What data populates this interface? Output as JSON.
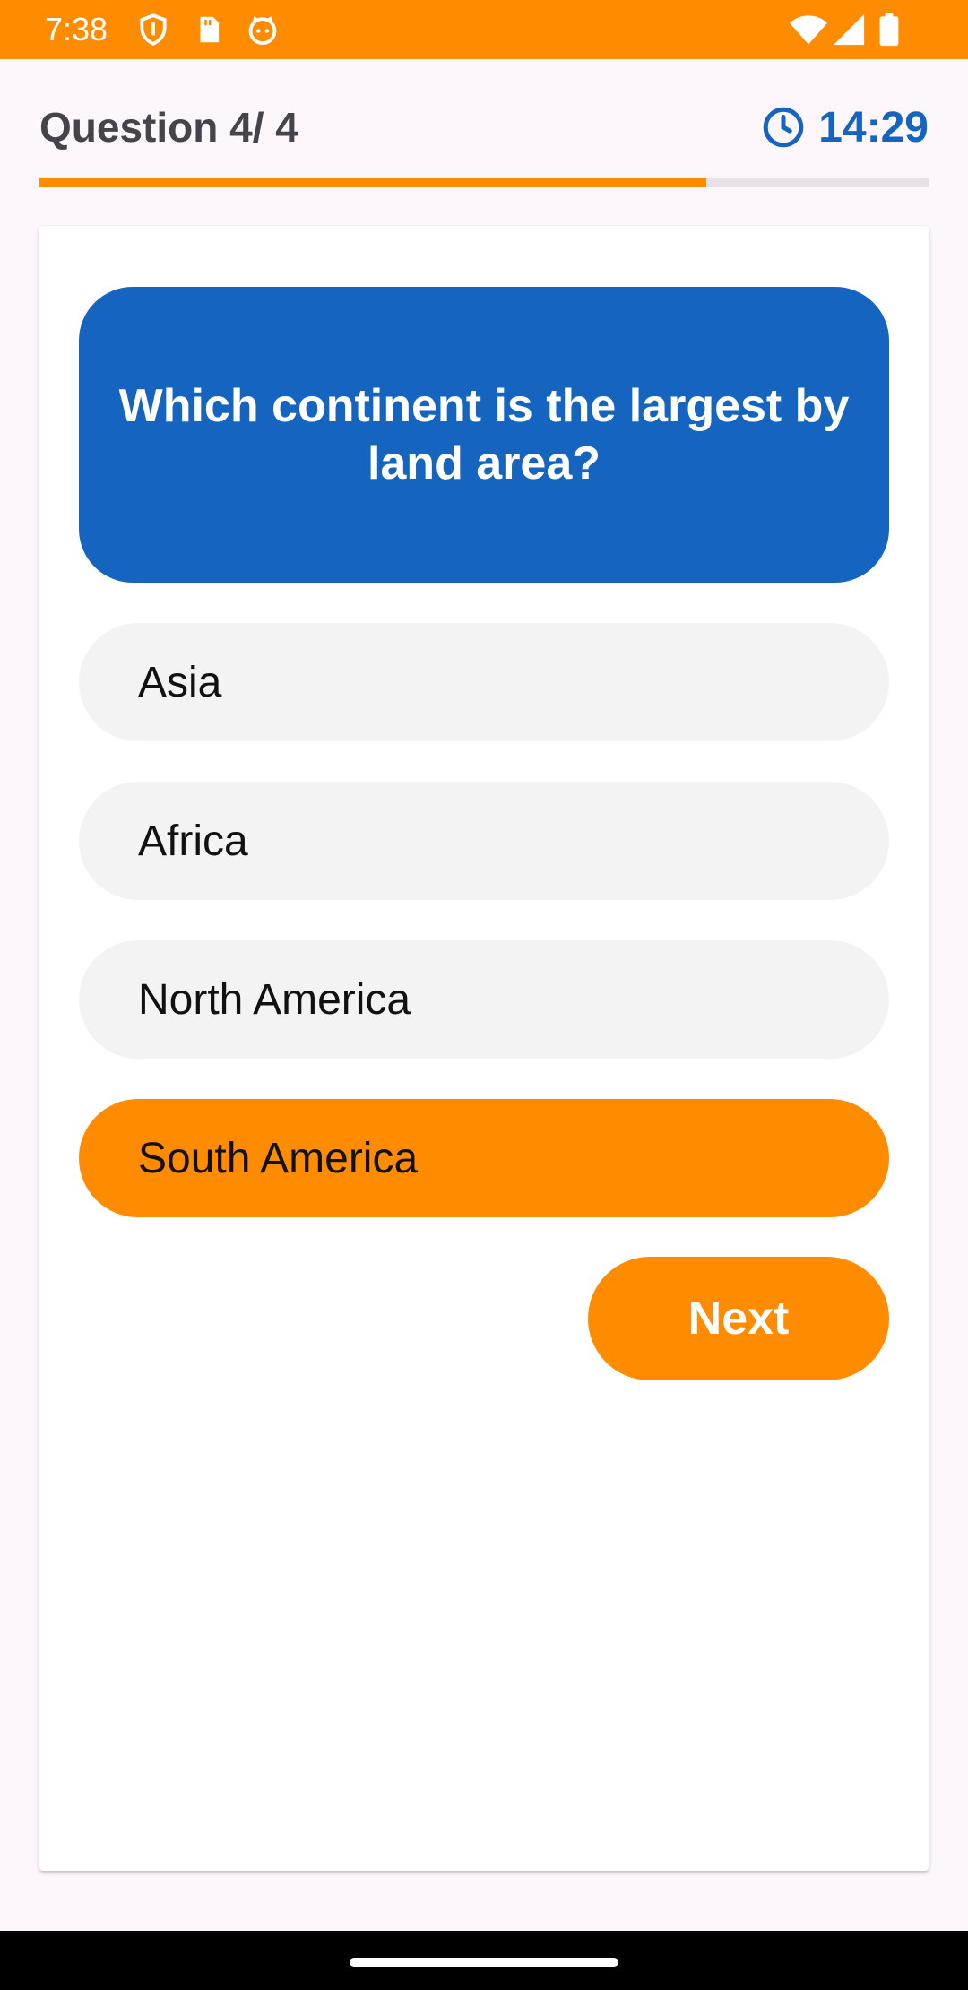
{
  "status_bar": {
    "time": "7:38",
    "left_icons": [
      "shield-icon",
      "sd-card-icon",
      "cat-face-icon"
    ],
    "right_icons": [
      "wifi-icon",
      "signal-icon",
      "battery-icon"
    ]
  },
  "header": {
    "question_counter": "Question 4/ 4",
    "timer": "14:29",
    "timer_icon": "clock-icon"
  },
  "progress": {
    "fraction": 0.75
  },
  "question": {
    "text": "Which continent is the largest by land area?"
  },
  "options": [
    {
      "label": "Asia",
      "selected": false
    },
    {
      "label": "Africa",
      "selected": false
    },
    {
      "label": "North America",
      "selected": false
    },
    {
      "label": "South America",
      "selected": true
    }
  ],
  "next_button": {
    "label": "Next"
  },
  "colors": {
    "accent": "#FF8C00",
    "primary": "#1565C0",
    "option_background": "#F3F3F3",
    "page_background": "#FDF7FC"
  }
}
